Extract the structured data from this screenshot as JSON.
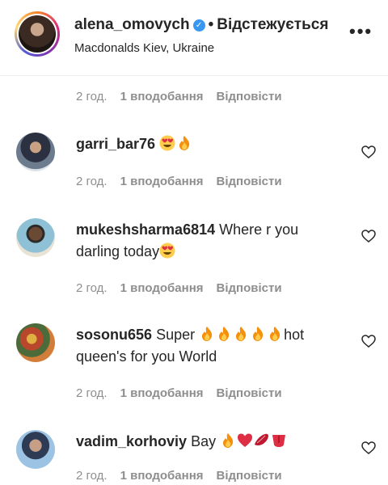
{
  "header": {
    "username": "alena_omovych",
    "verified_icon": "verified-badge-icon",
    "separator": "•",
    "follow_status": "Відстежується",
    "location": "Macdonalds Kiev, Ukraine",
    "more_icon": "more-options-icon",
    "more_glyph": "•••"
  },
  "top_meta": {
    "time": "2 год.",
    "likes": "1 вподобання",
    "reply": "Відповісти"
  },
  "comments": [
    {
      "username": "garri_bar76",
      "text": "",
      "emojis": [
        "heart-eyes",
        "fire"
      ],
      "time": "2 год.",
      "likes": "1 вподобання",
      "reply": "Відповісти"
    },
    {
      "username": "mukeshsharma6814",
      "text": "Where r you darling today",
      "emojis": [
        "heart-eyes"
      ],
      "time": "2 год.",
      "likes": "1 вподобання",
      "reply": "Відповісти"
    },
    {
      "username": "sosonu656",
      "text_before": "Super",
      "text_after": "hot queen's for you World",
      "emojis": [
        "fire",
        "fire",
        "fire",
        "fire",
        "fire"
      ],
      "time": "2 год.",
      "likes": "1 вподобання",
      "reply": "Відповісти"
    },
    {
      "username": "vadim_korhoviy",
      "text": "Bay",
      "emojis": [
        "fire",
        "red-heart",
        "lips",
        "tongue"
      ],
      "time": "2 год.",
      "likes": "1 вподобання",
      "reply": "Відповісти"
    }
  ],
  "colors": {
    "text": "#262626",
    "muted": "#8e8e8e",
    "verified": "#3897f0",
    "divider": "#efefef"
  }
}
